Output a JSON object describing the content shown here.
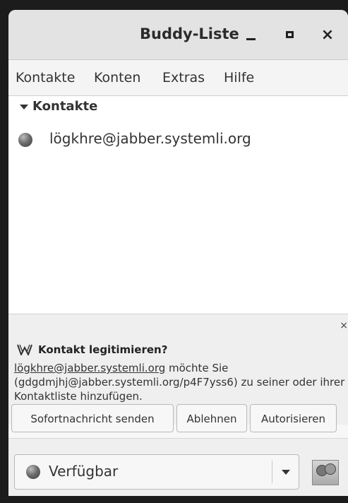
{
  "window": {
    "title": "Buddy-Liste",
    "minimize_icon": "minimize-icon",
    "maximize_icon": "maximize-icon",
    "close_glyph": "×"
  },
  "menubar": {
    "items": [
      {
        "label": "Kontakte"
      },
      {
        "label": "Konten"
      },
      {
        "label": "Extras"
      },
      {
        "label": "Hilfe"
      }
    ]
  },
  "contacts": {
    "group_label": "Kontakte",
    "items": [
      {
        "name": "lögkhre@jabber.systemli.org",
        "status_icon": "offline-status-icon"
      }
    ]
  },
  "notification": {
    "close_glyph": "×",
    "icon": "pidgin-icon",
    "title": "Kontakt legitimieren?",
    "link": "lögkhre@jabber.systemli.org",
    "text_after_link": " möchte Sie (gdgdmjhj@jabber.systemli.org/p4F7yss6) zu seiner oder ihrer Kontaktliste hinzufügen.",
    "buttons": {
      "send": "Sofortnachricht senden",
      "deny": "Ablehnen",
      "authorize": "Autorisieren"
    }
  },
  "status": {
    "selected": "Verfügbar",
    "icon": "available-status-icon",
    "avatar_icon": "buddy-icon"
  }
}
